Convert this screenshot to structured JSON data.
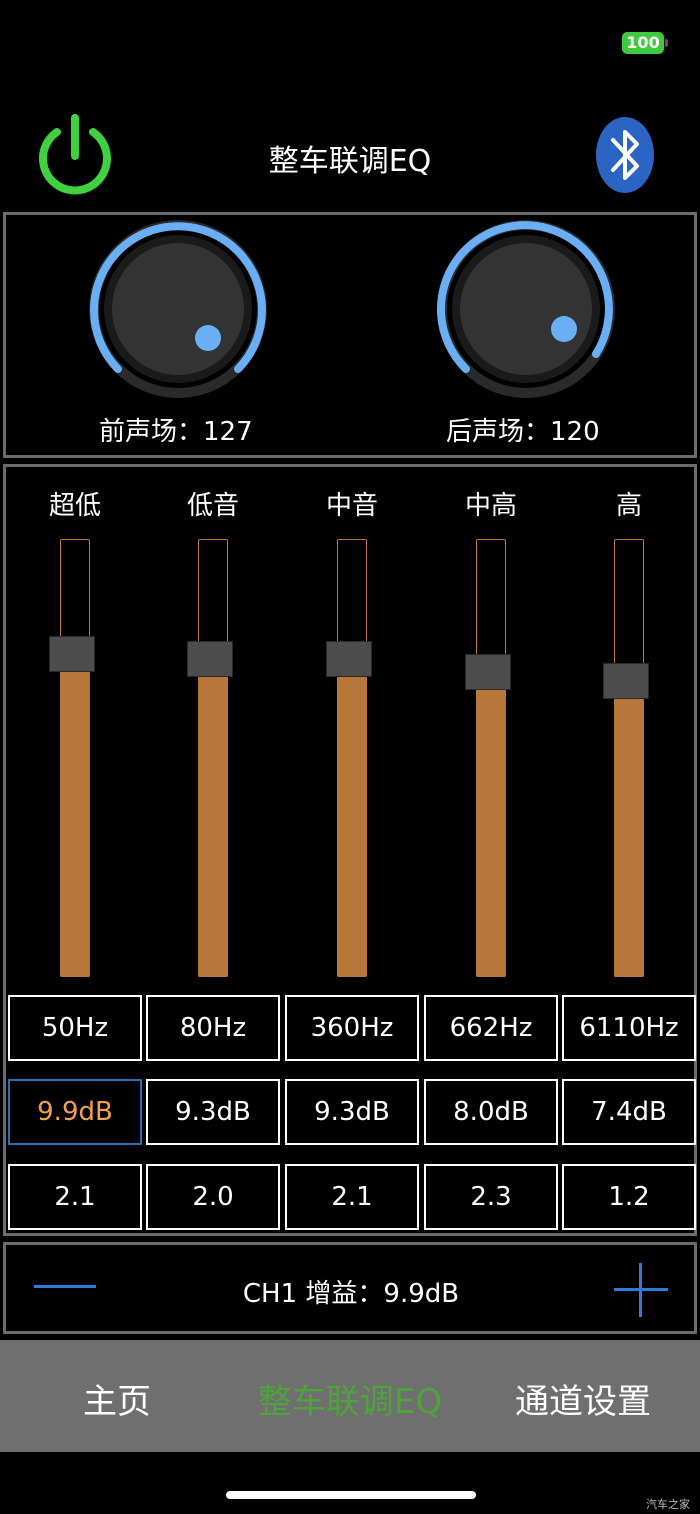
{
  "status_bar": {
    "battery": "100"
  },
  "header": {
    "title": "整车联调EQ"
  },
  "soundfield": {
    "front": {
      "label": "前声场：127",
      "value": 127
    },
    "rear": {
      "label": "后声场：120",
      "value": 120
    }
  },
  "bands": [
    {
      "name": "超低",
      "freq": "50Hz",
      "gain": "9.9dB",
      "q": "2.1",
      "level": 0.7
    },
    {
      "name": "低音",
      "freq": "80Hz",
      "gain": "9.3dB",
      "q": "2.0",
      "level": 0.69
    },
    {
      "name": "中音",
      "freq": "360Hz",
      "gain": "9.3dB",
      "q": "2.1",
      "level": 0.69
    },
    {
      "name": "中高",
      "freq": "662Hz",
      "gain": "8.0dB",
      "q": "2.3",
      "level": 0.66
    },
    {
      "name": "高",
      "freq": "6110Hz",
      "gain": "7.4dB",
      "q": "1.2",
      "level": 0.64
    }
  ],
  "selected_band": 0,
  "gain_control": {
    "label": "CH1 增益：9.9dB"
  },
  "tabbar": {
    "items": [
      "主页",
      "整车联调EQ",
      "通道设置"
    ],
    "active": 1
  },
  "watermark": "汽车之家",
  "colors": {
    "accent_green": "#4ea33c",
    "slider_orange": "#b8773a",
    "knob_blue": "#6aaef5",
    "selected_gain": "#f1a24c",
    "control_blue": "#2c7bd6"
  }
}
